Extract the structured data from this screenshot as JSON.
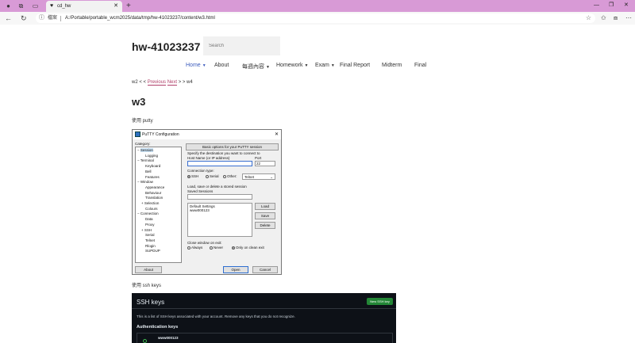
{
  "browser": {
    "tab_title": "cd_hw",
    "omnibox_label": "檔案",
    "url": "A:/Portable/portable_wcm2025/data/tmp/hw-41023237/content/w3.html"
  },
  "site": {
    "title": "hw-41023237",
    "search_placeholder": "Search",
    "menu": [
      "Home",
      "About",
      "每週內容",
      "Homework",
      "Exam",
      "Final Report",
      "Midterm",
      "Final"
    ]
  },
  "breadcrumb": {
    "prefix": "w2 < < ",
    "previous": "Previous",
    "next": "Next",
    "suffix": " > > w4"
  },
  "content": {
    "heading": "w3",
    "para1": "使用 putty",
    "para2": "使用 ssh keys"
  },
  "putty": {
    "title": "PuTTY Configuration",
    "category_label": "Category:",
    "tree": [
      {
        "label": "Session",
        "indent": 0,
        "toggle": "−"
      },
      {
        "label": "Logging",
        "indent": 2,
        "toggle": ""
      },
      {
        "label": "Terminal",
        "indent": 0,
        "toggle": "−"
      },
      {
        "label": "Keyboard",
        "indent": 2,
        "toggle": ""
      },
      {
        "label": "Bell",
        "indent": 2,
        "toggle": ""
      },
      {
        "label": "Features",
        "indent": 2,
        "toggle": ""
      },
      {
        "label": "Window",
        "indent": 0,
        "toggle": "−"
      },
      {
        "label": "Appearance",
        "indent": 2,
        "toggle": ""
      },
      {
        "label": "Behaviour",
        "indent": 2,
        "toggle": ""
      },
      {
        "label": "Translation",
        "indent": 2,
        "toggle": ""
      },
      {
        "label": "Selection",
        "indent": 1,
        "toggle": "+"
      },
      {
        "label": "Colours",
        "indent": 2,
        "toggle": ""
      },
      {
        "label": "Connection",
        "indent": 0,
        "toggle": "−"
      },
      {
        "label": "Data",
        "indent": 2,
        "toggle": ""
      },
      {
        "label": "Proxy",
        "indent": 2,
        "toggle": ""
      },
      {
        "label": "SSH",
        "indent": 1,
        "toggle": "+"
      },
      {
        "label": "Serial",
        "indent": 2,
        "toggle": ""
      },
      {
        "label": "Telnet",
        "indent": 2,
        "toggle": ""
      },
      {
        "label": "Rlogin",
        "indent": 2,
        "toggle": ""
      },
      {
        "label": "SUPDUP",
        "indent": 2,
        "toggle": ""
      }
    ],
    "header_button": "Basic options for your PuTTY session",
    "dest_label": "Specify the destination you want to connect to",
    "host_label": "Host Name (or IP address)",
    "port_label": "Port",
    "port_value": "22",
    "conn_type_label": "Connection type:",
    "conn_types": [
      "SSH",
      "Serial",
      "Other:"
    ],
    "other_select": "Telnet",
    "load_save_label": "Load, save or delete a stored session",
    "saved_label": "Saved Sessions",
    "sessions": [
      "Default Settings",
      "www000123"
    ],
    "load": "Load",
    "save": "Save",
    "delete": "Delete",
    "close_label": "Close window on exit:",
    "close_options": [
      "Always",
      "Never",
      "Only on clean exit"
    ],
    "about": "About",
    "open": "Open",
    "cancel": "Cancel"
  },
  "ssh_keys": {
    "title": "SSH keys",
    "new_button": "New SSH key",
    "description": "This is a list of SSH keys associated with your account. Remove any keys that you do not recognize.",
    "auth_heading": "Authentication keys",
    "key_name": "www000123"
  }
}
